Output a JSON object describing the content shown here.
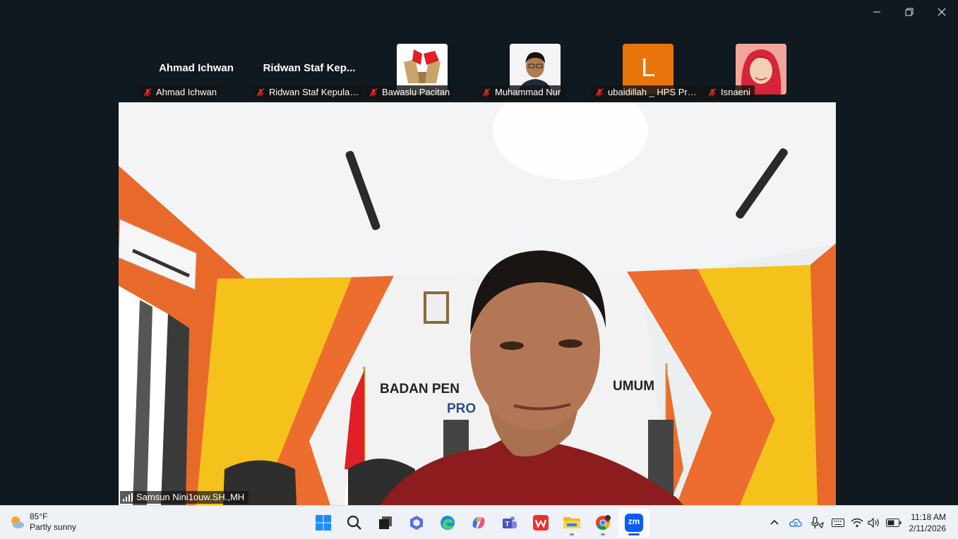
{
  "window": {
    "minimize_icon": "minimize-icon",
    "restore_icon": "restore-icon",
    "close_icon": "close-icon"
  },
  "participants": [
    {
      "display": "Ahmad Ichwan",
      "label": "Ahmad Ichwan"
    },
    {
      "display": "Ridwan Staf Kep...",
      "label": "Ridwan Staf Kepulaua..."
    },
    {
      "label": "Bawaslu Pacitan"
    },
    {
      "label": "Muhammad Nur"
    },
    {
      "initial": "L",
      "label": "ubaidillah _ HPS Prob..."
    },
    {
      "label": "Isnaeni"
    }
  ],
  "main_video": {
    "speaker": "Samsun Nini1ouw.SH.,MH",
    "wall_text_line1": "BADAN PEN",
    "wall_text_line1b": "UMUM",
    "wall_text_line2": "PRO"
  },
  "colors": {
    "zoom_blue": "#0b5cff",
    "avatar_orange": "#e8740c",
    "muted_red": "#e02828"
  },
  "taskbar": {
    "weather": {
      "temp": "85°F",
      "condition": "Partly sunny"
    },
    "apps": [
      "start-icon",
      "search-icon",
      "task-view-icon",
      "copilot-icon",
      "edge-icon",
      "copilot-app-icon",
      "teams-icon",
      "wps-icon",
      "file-explorer-icon",
      "chrome-icon",
      "zoom-icon"
    ],
    "zoom_label": "zm",
    "clock": {
      "time": "11:18 AM",
      "date": "2/11/2026"
    }
  }
}
